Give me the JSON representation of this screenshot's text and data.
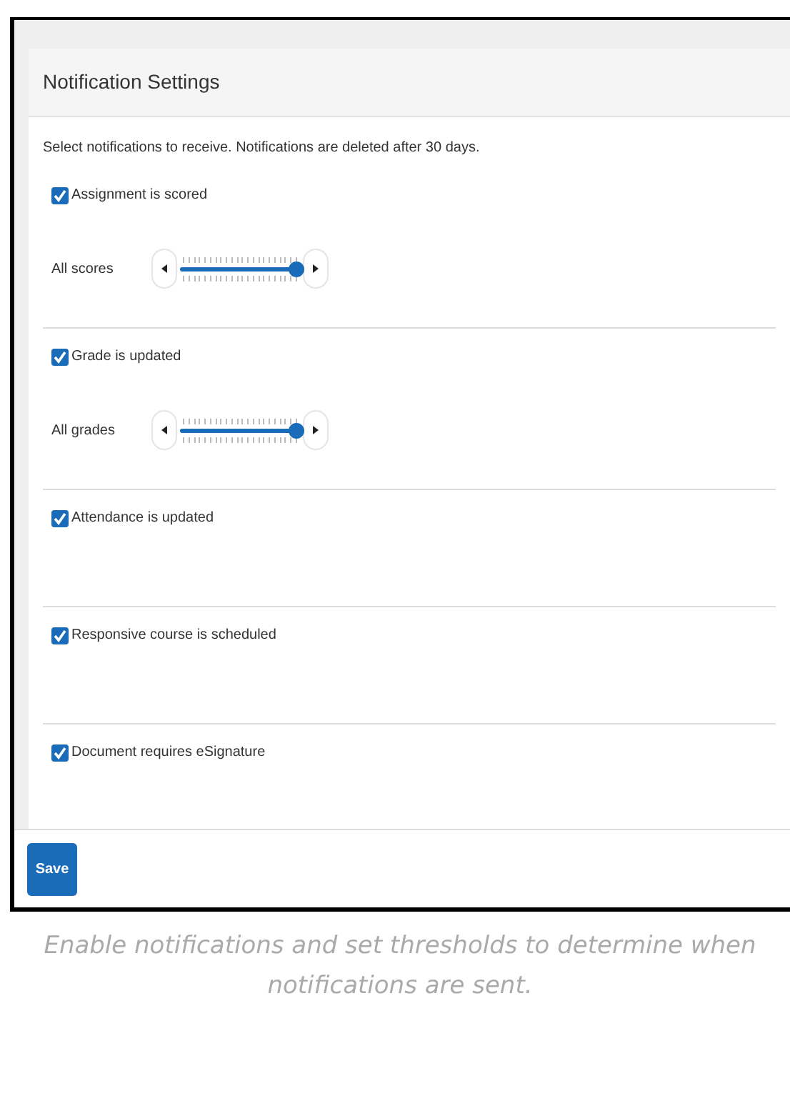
{
  "panel": {
    "title": "Notification Settings",
    "intro": "Select notifications to receive. Notifications are deleted after 30 days."
  },
  "items": [
    {
      "kind": "slider",
      "label": "Assignment is scored",
      "checked": true,
      "slider_label": "All scores",
      "level": 1
    },
    {
      "kind": "slider",
      "label": "Grade is updated",
      "checked": true,
      "slider_label": "All grades",
      "level": 1
    },
    {
      "kind": "plain",
      "label": "Attendance is updated",
      "checked": true
    },
    {
      "kind": "plain",
      "label": "Responsive course is scheduled",
      "checked": true
    },
    {
      "kind": "plain",
      "label": "Document requires eSignature",
      "checked": true
    }
  ],
  "save_button": "Save",
  "caption": "Enable notifications and set thresholds to determine when notifications are sent."
}
